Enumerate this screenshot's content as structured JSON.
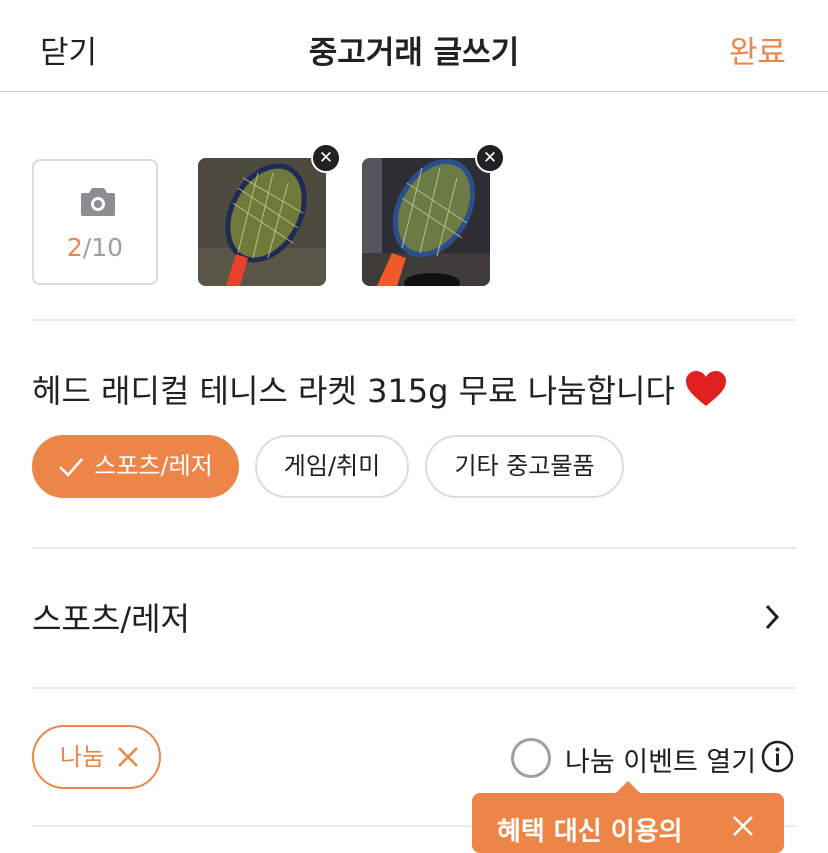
{
  "header": {
    "close_label": "닫기",
    "title": "중고거래 글쓰기",
    "done_label": "완료"
  },
  "photos": {
    "current_count": "2",
    "max_count": "/10",
    "remove_symbol": "✕",
    "items": [
      {
        "description": "tennis racket photo 1"
      },
      {
        "description": "tennis racket photo 2"
      }
    ]
  },
  "post": {
    "title": "헤드 래디컬 테니스 라켓 315g 무료 나눔합니다"
  },
  "category_chips": [
    {
      "label": "스포츠/레저",
      "selected": true
    },
    {
      "label": "게임/취미",
      "selected": false
    },
    {
      "label": "기타 중고물품",
      "selected": false
    }
  ],
  "category_selector": {
    "label": "스포츠/레저"
  },
  "price": {
    "share_tag_label": "나눔",
    "event_label": "나눔 이벤트 열기"
  },
  "tooltip": {
    "text": "혜택 대신 이용의"
  },
  "colors": {
    "accent": "#ee8548",
    "text": "#212124",
    "muted": "#9e9ea3",
    "divider": "#e9ecef"
  }
}
